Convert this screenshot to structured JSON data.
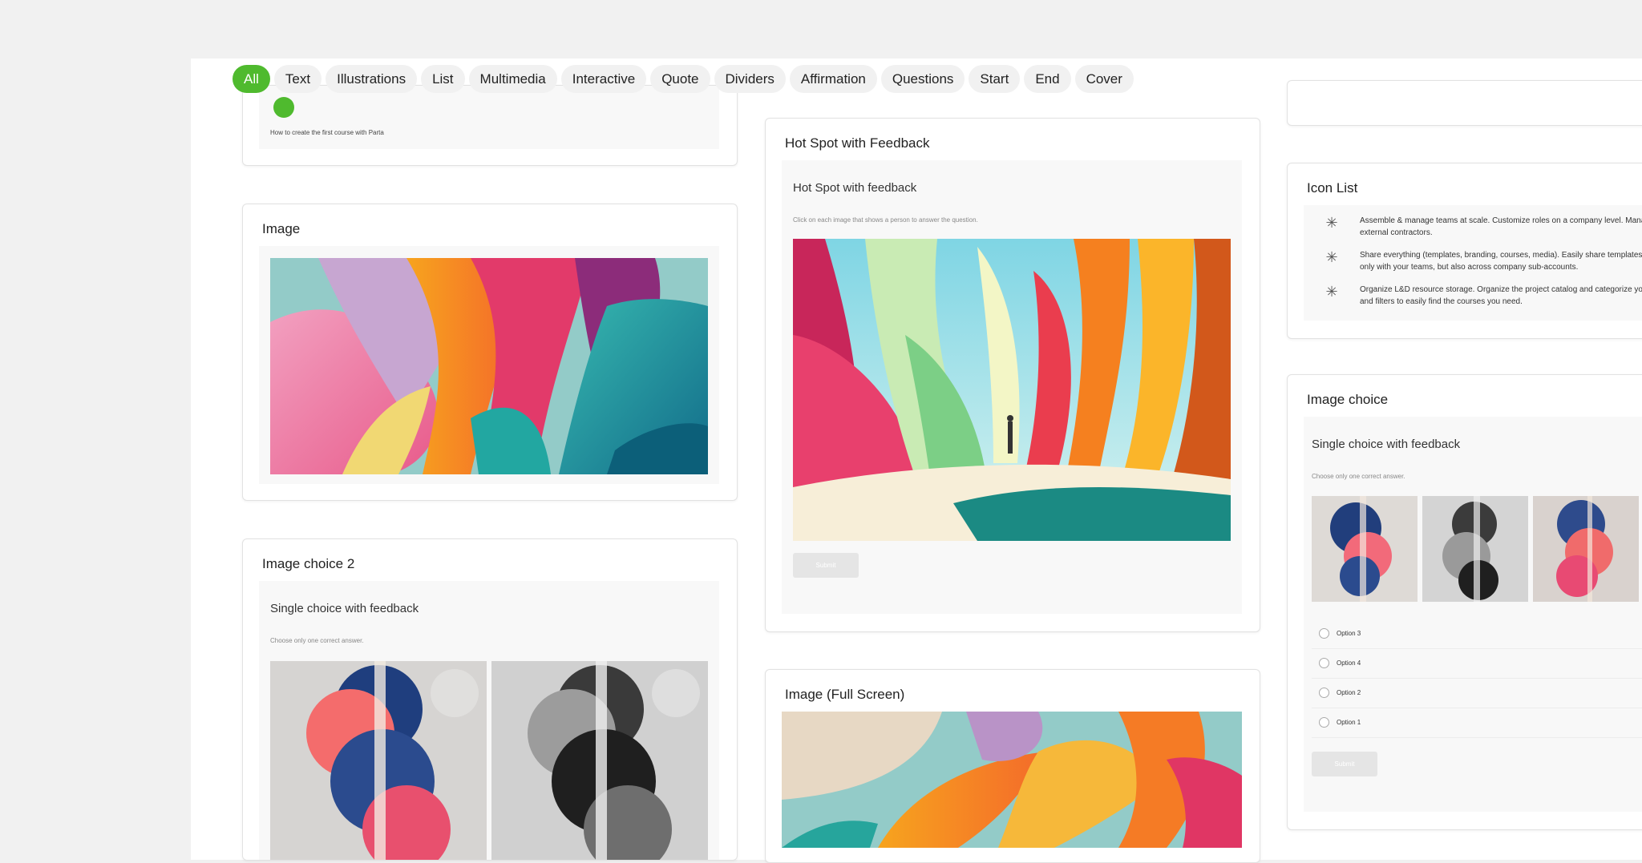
{
  "tabs": [
    "All",
    "Text",
    "Illustrations",
    "List",
    "Multimedia",
    "Interactive",
    "Quote",
    "Dividers",
    "Affirmation",
    "Questions",
    "Start",
    "End",
    "Cover"
  ],
  "colors": {
    "accent": "#4fba2e",
    "background": "#f1f1f1",
    "panel": "#ffffff"
  },
  "top_card": {
    "text": "How to create the first course with Parta"
  },
  "image_card": {
    "title": "Image"
  },
  "image_choice2": {
    "title": "Image choice 2",
    "question": "Single choice with feedback",
    "subtitle": "Choose only one correct answer."
  },
  "hotspot": {
    "title": "Hot Spot with Feedback",
    "question": "Hot Spot with feedback",
    "subtitle": "Click on each image that shows a person to answer the question.",
    "submit": "Submit"
  },
  "fullscreen": {
    "title": "Image (Full Screen)"
  },
  "icon_list": {
    "title": "Icon List",
    "items": [
      {
        "icon": "asterisk-icon",
        "line1": "Assemble & manage teams at scale. Customize roles on a company level. Mana",
        "line2": "external contractors."
      },
      {
        "icon": "asterisk-icon",
        "line1": "Share everything (templates, branding, courses, media). Easily share templates",
        "line2": "only with your teams, but also across company sub-accounts."
      },
      {
        "icon": "asterisk-icon",
        "line1": "Organize L&D resource storage. Organize the project catalog and categorize yo",
        "line2": "and filters to easily find the courses you need."
      }
    ]
  },
  "image_choice": {
    "title": "Image choice",
    "question": "Single choice with feedback",
    "subtitle": "Choose only one correct answer.",
    "options": [
      "Option 3",
      "Option 4",
      "Option 2",
      "Option 1"
    ],
    "submit": "Submit"
  }
}
